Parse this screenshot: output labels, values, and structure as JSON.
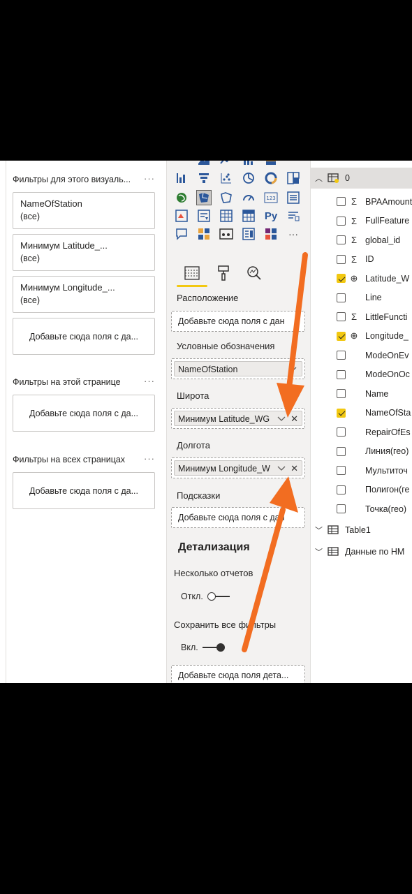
{
  "filters": {
    "visual_section": "Фильтры для этого визуаль...",
    "visual_dots": "···",
    "cards": [
      {
        "title": "NameOfStation",
        "value": "(все)"
      },
      {
        "title": "Минимум Latitude_...",
        "value": "(все)"
      },
      {
        "title": "Минимум Longitude_...",
        "value": "(все)"
      }
    ],
    "visual_drop": "Добавьте сюда поля с да...",
    "page_section": "Фильтры на этой странице",
    "page_dots": "···",
    "page_drop": "Добавьте сюда поля с да...",
    "all_section": "Фильтры на всех страницах",
    "all_dots": "···",
    "all_drop": "Добавьте сюда поля с да..."
  },
  "viz": {
    "more_dots": "···",
    "wells": {
      "location_label": "Расположение",
      "location_placeholder": "Добавьте сюда поля с дан",
      "legend_label": "Условные обозначения",
      "legend_value": "NameOfStation",
      "lat_label": "Широта",
      "lat_value": "Минимум Latitude_WG",
      "lon_label": "Долгота",
      "lon_value": "Минимум Longitude_W",
      "tooltips_label": "Подсказки",
      "tooltips_placeholder": "Добавьте сюда поля с дан"
    },
    "drill": {
      "heading": "Детализация",
      "multi_reports_label": "Несколько отчетов",
      "multi_reports_state": "Откл.",
      "keep_filters_label": "Сохранить все фильтры",
      "keep_filters_state": "Вкл.",
      "drop_placeholder": "Добавьте сюда поля дета..."
    },
    "icons": [
      "table-row-chart",
      "funnel-chart",
      "scatter-chart",
      "pie-chart",
      "donut-chart",
      "treemap-chart",
      "map",
      "filled-map",
      "shape-map",
      "gauge",
      "card",
      "multi-row-card",
      "kpi",
      "slicer",
      "table",
      "matrix",
      "python-visual",
      "smart-narrative",
      "qa",
      "key-influencers",
      "decomposition-tree",
      "paginated-report",
      "power-apps",
      "more"
    ],
    "accent": "#f2c811"
  },
  "fields": {
    "tables": [
      {
        "name": "0",
        "expanded": true
      },
      {
        "name": "Table1",
        "expanded": false
      },
      {
        "name": "Данные по НМ",
        "expanded": false
      }
    ],
    "items": [
      {
        "name": "BPAAmount",
        "type": "sigma",
        "checked": false
      },
      {
        "name": "FullFeature",
        "type": "sigma",
        "checked": false
      },
      {
        "name": "global_id",
        "type": "sigma",
        "checked": false
      },
      {
        "name": "ID",
        "type": "sigma",
        "checked": false
      },
      {
        "name": "Latitude_W",
        "type": "globe",
        "checked": true
      },
      {
        "name": "Line",
        "type": "none",
        "checked": false
      },
      {
        "name": "LittleFuncti",
        "type": "sigma",
        "checked": false
      },
      {
        "name": "Longitude_",
        "type": "globe",
        "checked": true
      },
      {
        "name": "ModeOnEv",
        "type": "none",
        "checked": false
      },
      {
        "name": "ModeOnOc",
        "type": "none",
        "checked": false
      },
      {
        "name": "Name",
        "type": "none",
        "checked": false
      },
      {
        "name": "NameOfSta",
        "type": "none",
        "checked": true
      },
      {
        "name": "RepairOfEs",
        "type": "none",
        "checked": false
      },
      {
        "name": "Линия(гео)",
        "type": "none",
        "checked": false
      },
      {
        "name": "Мультиточ",
        "type": "none",
        "checked": false
      },
      {
        "name": "Полигон(ге",
        "type": "none",
        "checked": false
      },
      {
        "name": "Точка(гео)",
        "type": "none",
        "checked": false
      }
    ]
  },
  "annotation_color": "#f26d21"
}
